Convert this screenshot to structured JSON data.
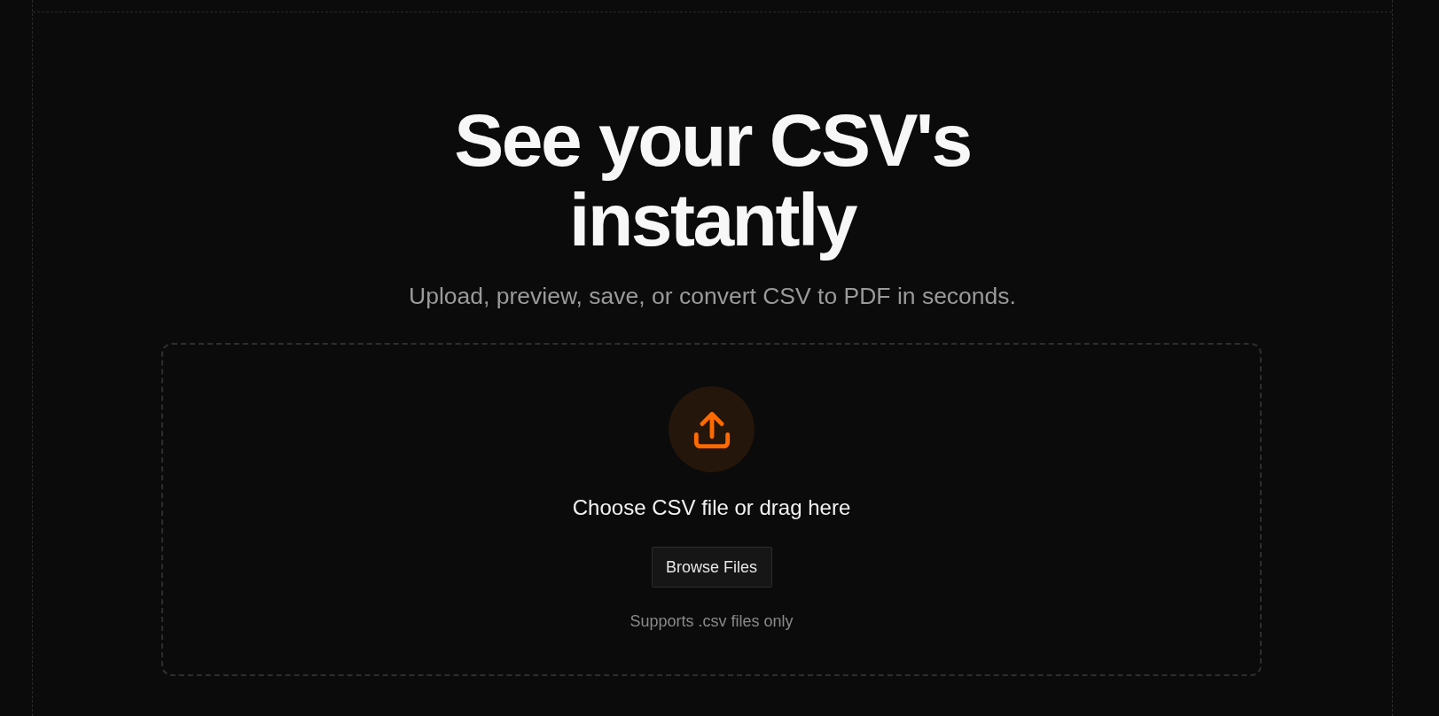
{
  "hero": {
    "title": "See your CSV's instantly",
    "subtitle": "Upload, preview, save, or convert CSV to PDF in seconds."
  },
  "dropzone": {
    "prompt": "Choose CSV file or drag here",
    "button": "Browse Files",
    "note": "Supports .csv files only"
  }
}
